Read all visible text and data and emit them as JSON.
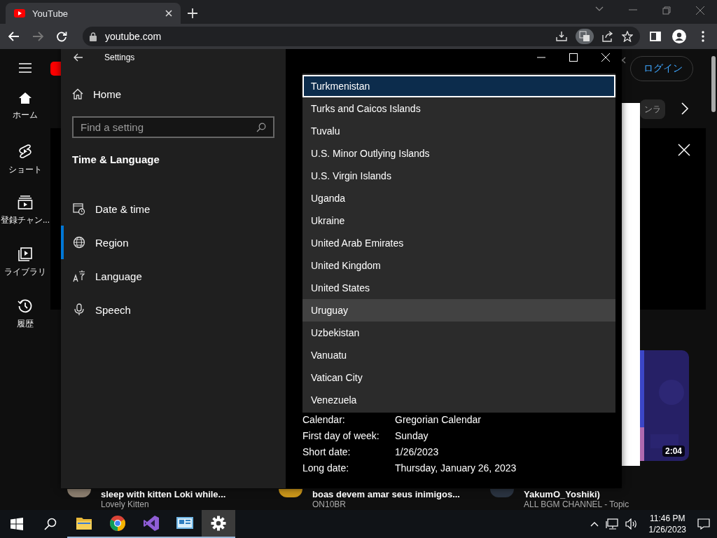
{
  "browser": {
    "tab": {
      "title": "YouTube"
    },
    "address": "youtube.com"
  },
  "youtube": {
    "nav": [
      {
        "label": "ホーム",
        "kind": "home"
      },
      {
        "label": "ショート",
        "kind": "shorts"
      },
      {
        "label": "登録チャン...",
        "kind": "subscriptions"
      },
      {
        "label": "ライブラリ",
        "kind": "library"
      },
      {
        "label": "履歴",
        "kind": "history"
      }
    ],
    "login": "ログイン",
    "chip": "ンラ",
    "duration": "2:04",
    "videos": [
      {
        "title": "sleep with kitten Loki while...",
        "channel": "Lovely Kitten"
      },
      {
        "title": "boas devem amar seus inimigos...",
        "channel": "ON10BR"
      },
      {
        "title": "YakumO_Yoshiki)",
        "channel": "ALL BGM CHANNEL - Topic"
      }
    ]
  },
  "settings": {
    "title": "Settings",
    "home": "Home",
    "search": {
      "placeholder": "Find a setting"
    },
    "section": "Time & Language",
    "nav": [
      {
        "label": "Date & time",
        "kind": "clock",
        "selected": false
      },
      {
        "label": "Region",
        "kind": "globe",
        "selected": true
      },
      {
        "label": "Language",
        "kind": "language",
        "selected": false
      },
      {
        "label": "Speech",
        "kind": "mic",
        "selected": false
      }
    ],
    "dropdown": {
      "items": [
        {
          "label": "Turkmenistan",
          "selected": true,
          "hovered": false
        },
        {
          "label": "Turks and Caicos Islands",
          "selected": false,
          "hovered": false
        },
        {
          "label": "Tuvalu",
          "selected": false,
          "hovered": false
        },
        {
          "label": "U.S. Minor Outlying Islands",
          "selected": false,
          "hovered": false
        },
        {
          "label": "U.S. Virgin Islands",
          "selected": false,
          "hovered": false
        },
        {
          "label": "Uganda",
          "selected": false,
          "hovered": false
        },
        {
          "label": "Ukraine",
          "selected": false,
          "hovered": false
        },
        {
          "label": "United Arab Emirates",
          "selected": false,
          "hovered": false
        },
        {
          "label": "United Kingdom",
          "selected": false,
          "hovered": false
        },
        {
          "label": "United States",
          "selected": false,
          "hovered": false
        },
        {
          "label": "Uruguay",
          "selected": false,
          "hovered": true
        },
        {
          "label": "Uzbekistan",
          "selected": false,
          "hovered": false
        },
        {
          "label": "Vanuatu",
          "selected": false,
          "hovered": false
        },
        {
          "label": "Vatican City",
          "selected": false,
          "hovered": false
        },
        {
          "label": "Venezuela",
          "selected": false,
          "hovered": false
        }
      ]
    },
    "formats": [
      {
        "label": "Calendar:",
        "value": "Gregorian Calendar"
      },
      {
        "label": "First day of week:",
        "value": "Sunday"
      },
      {
        "label": "Short date:",
        "value": "1/26/2023"
      },
      {
        "label": "Long date:",
        "value": "Thursday, January 26, 2023"
      }
    ]
  },
  "taskbar": {
    "apps": [
      {
        "kind": "folder",
        "active": false
      },
      {
        "kind": "chrome",
        "active": false
      },
      {
        "kind": "studio",
        "active": false
      },
      {
        "kind": "panel",
        "active": false
      },
      {
        "kind": "gear",
        "active": true
      }
    ],
    "time": "11:46 PM",
    "date": "1/26/2023"
  }
}
